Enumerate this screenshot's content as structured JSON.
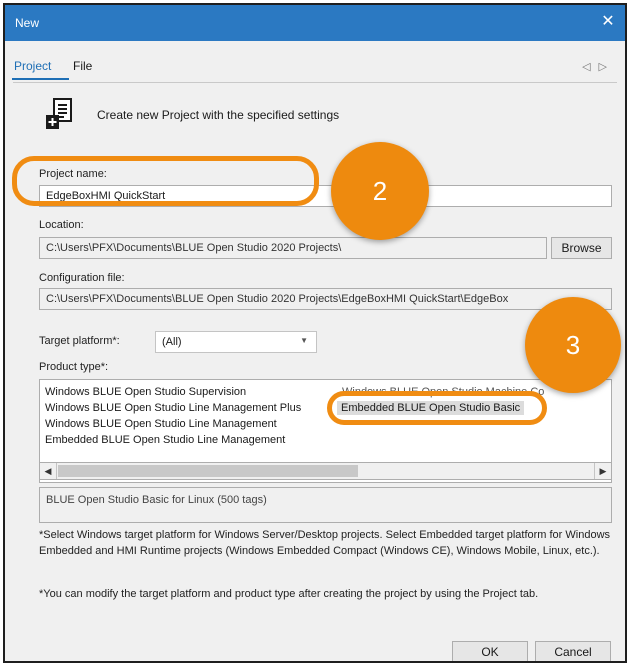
{
  "window": {
    "title": "New",
    "close_glyph": "✕"
  },
  "tabs": [
    {
      "label": "Project",
      "active": true
    },
    {
      "label": "File",
      "active": false
    }
  ],
  "tab_scroll": {
    "left": "◁",
    "right": "▷"
  },
  "header": {
    "icon": "new-project-icon",
    "text": "Create new Project with the specified settings"
  },
  "project_name": {
    "label": "Project name:",
    "value": "EdgeBoxHMI QuickStart"
  },
  "location": {
    "label": "Location:",
    "value": "C:\\Users\\PFX\\Documents\\BLUE Open Studio 2020 Projects\\",
    "browse_label": "Browse"
  },
  "configuration": {
    "label": "Configuration file:",
    "value": "C:\\Users\\PFX\\Documents\\BLUE Open Studio 2020 Projects\\EdgeBoxHMI QuickStart\\EdgeBox"
  },
  "target_platform": {
    "label": "Target platform*:",
    "value": "(All)",
    "arrow": "▼"
  },
  "product_type": {
    "label": "Product type*:",
    "column1": [
      "Windows BLUE Open Studio Supervision",
      "Windows BLUE Open Studio Line Management Plus",
      "Windows BLUE Open Studio Line Management",
      "Embedded BLUE Open Studio Line Management"
    ],
    "column2_partial": "Windows BLUE Open Studio Machine Co",
    "selected": "Embedded BLUE Open Studio Basic",
    "scroll_left": "◀",
    "scroll_right": "▶"
  },
  "product_description": "BLUE Open Studio Basic for Linux (500 tags)",
  "notes": [
    "*Select Windows target platform for Windows Server/Desktop projects. Select Embedded target platform for Windows Embedded and HMI Runtime projects (Windows Embedded Compact (Windows CE), Windows Mobile, Linux, etc.).",
    "*You can modify the target platform and product type after creating the project by using the Project tab."
  ],
  "buttons": {
    "ok": "OK",
    "cancel": "Cancel"
  },
  "annotations": {
    "badge2": "2",
    "badge3": "3",
    "color": "#f08c12"
  }
}
